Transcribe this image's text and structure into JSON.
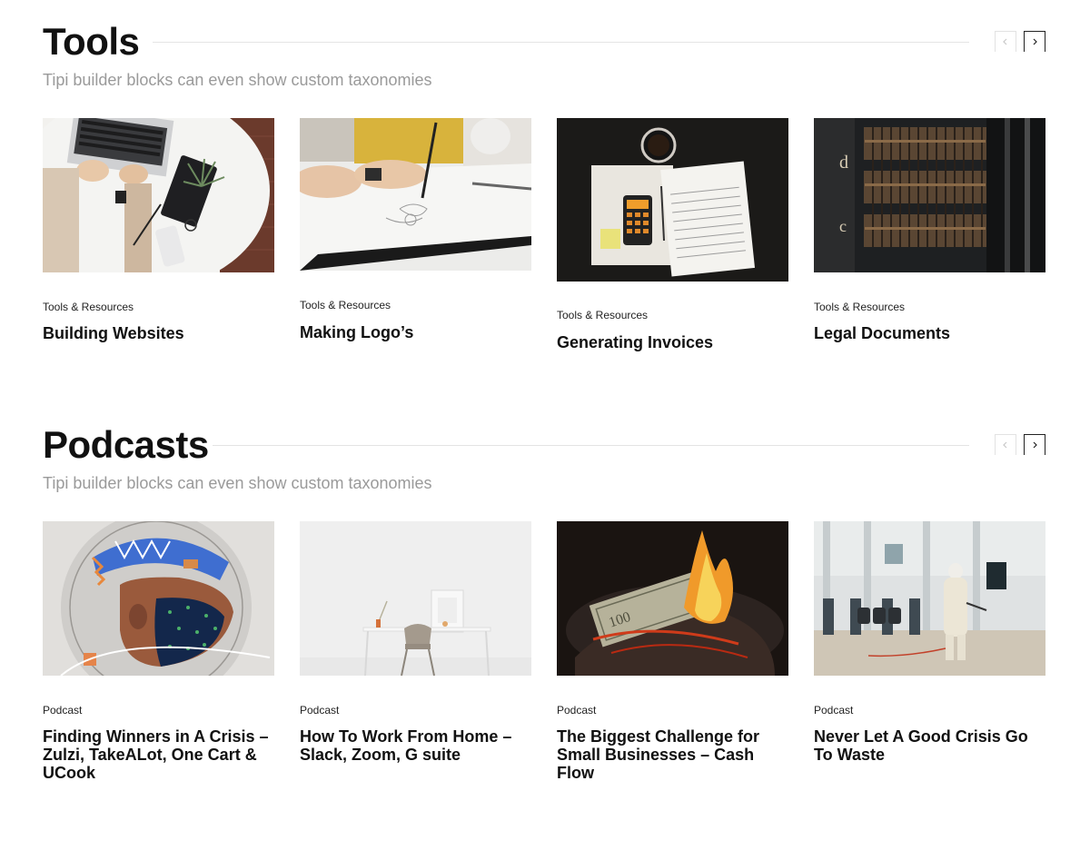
{
  "sections": [
    {
      "id": "tools",
      "title": "Tools",
      "subtitle": "Tipi builder blocks can even show custom taxonomies",
      "prev_icon": "chevron-left-icon",
      "next_icon": "chevron-right-icon",
      "cards": [
        {
          "category": "Tools & Resources",
          "title": "Building Websites",
          "image": "laptop-typing-photo"
        },
        {
          "category": "Tools & Resources",
          "title": "Making Logo’s",
          "image": "sketching-hand-photo"
        },
        {
          "category": "Tools & Resources",
          "title": "Generating Invoices",
          "image": "tax-forms-calculator-photo"
        },
        {
          "category": "Tools & Resources",
          "title": "Legal Documents",
          "image": "library-bookshelf-photo"
        }
      ]
    },
    {
      "id": "podcasts",
      "title": "Podcasts",
      "subtitle": "Tipi builder blocks can even show custom taxonomies",
      "prev_icon": "chevron-left-icon",
      "next_icon": "chevron-right-icon",
      "cards": [
        {
          "category": "Podcast",
          "title": "Finding Winners in A Crisis – Zulzi, TakeALot, One Cart & UCook",
          "image": "masked-face-illustration"
        },
        {
          "category": "Podcast",
          "title": "How To Work From Home – Slack, Zoom, G suite",
          "image": "minimal-desk-photo"
        },
        {
          "category": "Podcast",
          "title": "The Biggest Challenge for Small Businesses – Cash Flow",
          "image": "burning-money-photo"
        },
        {
          "category": "Podcast",
          "title": "Never Let A Good Crisis Go To Waste",
          "image": "disinfection-worker-photo"
        }
      ]
    }
  ],
  "colors": {
    "heading": "#111111",
    "subtitle": "#9a9a9a",
    "rule": "#e4e4e4",
    "nav_active_border": "#222222",
    "nav_inactive_border": "#e2e2e2"
  }
}
